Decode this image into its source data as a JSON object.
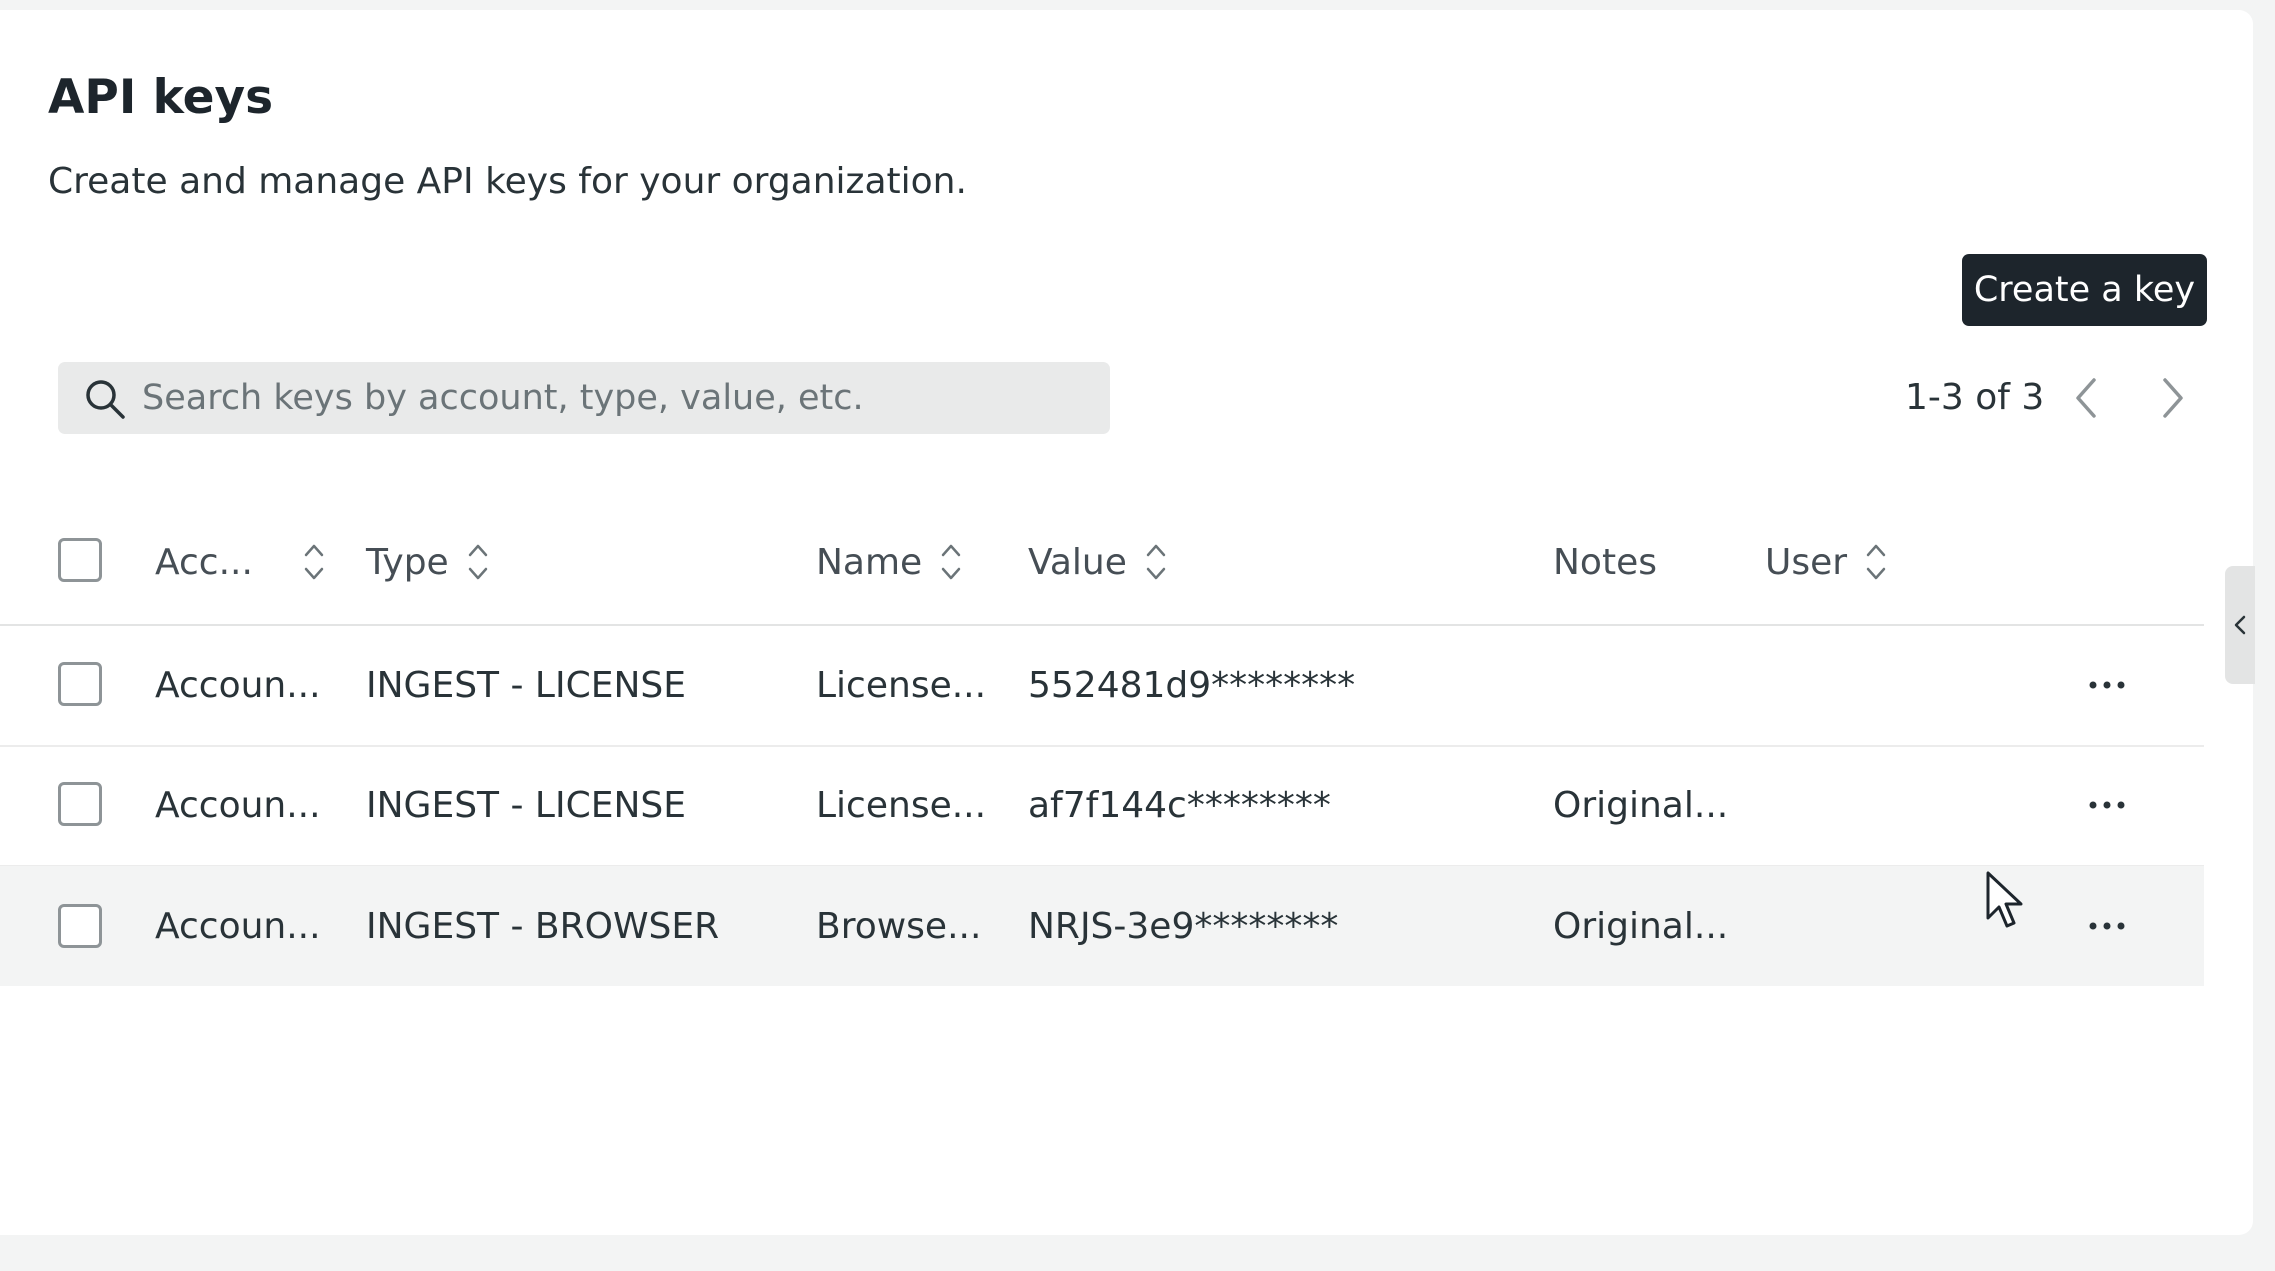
{
  "page": {
    "title": "API keys",
    "subtitle": "Create and manage API keys for your organization.",
    "create_button_label": "Create a key"
  },
  "search": {
    "placeholder": "Search keys by account, type, value, etc.",
    "value": ""
  },
  "pagination": {
    "range_text": "1-3 of 3"
  },
  "table": {
    "columns": {
      "account": "Acc...",
      "type": "Type",
      "name": "Name",
      "value": "Value",
      "notes": "Notes",
      "user": "User"
    },
    "rows": [
      {
        "account": "Accoun...",
        "type": "INGEST - LICENSE",
        "name": "License...",
        "value": "552481d9********",
        "notes": "",
        "user": ""
      },
      {
        "account": "Accoun...",
        "type": "INGEST - LICENSE",
        "name": "License...",
        "value": "af7f144c********",
        "notes": "Original...",
        "user": ""
      },
      {
        "account": "Accoun...",
        "type": "INGEST - BROWSER",
        "name": "Browse...",
        "value": "NRJS-3e9********",
        "notes": "Original...",
        "user": ""
      }
    ]
  },
  "icons": {
    "search": "search-icon",
    "sort": "sort-icon",
    "more": "more-icon",
    "prev": "chevron-left-icon",
    "next": "chevron-right-icon",
    "collapse": "chevron-left-icon"
  },
  "colors": {
    "button_bg": "#1d252c",
    "hover_row_bg": "#f3f4f4",
    "search_bg": "#e9eaea"
  }
}
